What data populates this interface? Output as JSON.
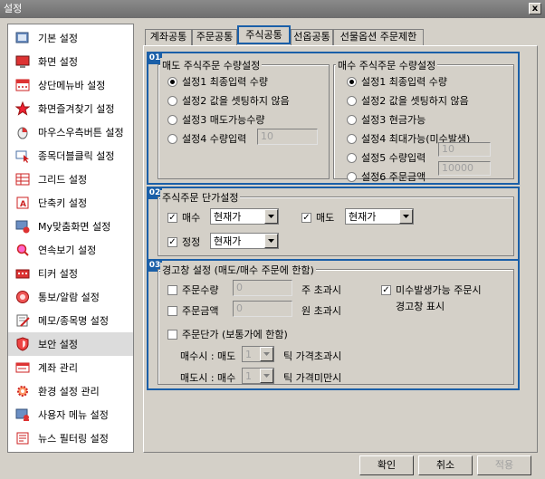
{
  "window": {
    "title": "설정",
    "close_label": "x"
  },
  "sidebar": {
    "items": [
      {
        "label": "기본 설정",
        "icon": "settings-icon"
      },
      {
        "label": "화면 설정",
        "icon": "monitor-icon"
      },
      {
        "label": "상단메뉴바 설정",
        "icon": "menubar-icon"
      },
      {
        "label": "화면즐겨찾기 설정",
        "icon": "star-icon"
      },
      {
        "label": "마우스우측버튼 설정",
        "icon": "mouse-icon"
      },
      {
        "label": "종목더블클릭 설정",
        "icon": "cursor-icon"
      },
      {
        "label": "그리드 설정",
        "icon": "grid-icon"
      },
      {
        "label": "단축키 설정",
        "icon": "shortcut-icon"
      },
      {
        "label": "My맞춤화면 설정",
        "icon": "custom-screen-icon"
      },
      {
        "label": "연속보기 설정",
        "icon": "magnifier-icon"
      },
      {
        "label": "티커 설정",
        "icon": "ticker-icon"
      },
      {
        "label": "통보/알람 설정",
        "icon": "alarm-icon"
      },
      {
        "label": "메모/종목명 설정",
        "icon": "memo-icon"
      },
      {
        "label": "보안 설정",
        "icon": "shield-icon"
      },
      {
        "label": "계좌 관리",
        "icon": "account-icon"
      },
      {
        "label": "환경 설정 관리",
        "icon": "gear-icon"
      },
      {
        "label": "사용자 메뉴 설정",
        "icon": "user-menu-icon"
      },
      {
        "label": "뉴스 필터링 설정",
        "icon": "news-icon"
      }
    ],
    "active_index": 13
  },
  "tabs": [
    {
      "label": "계좌공통"
    },
    {
      "label": "주문공통"
    },
    {
      "label": "주식공통"
    },
    {
      "label": "선옵공통"
    },
    {
      "label": "선물옵션 주문제한"
    }
  ],
  "active_tab": 2,
  "section1": {
    "badge": "01",
    "sell": {
      "legend": "매도 주식주문 수량설정",
      "options": [
        "설정1 최종입력 수량",
        "설정2 값을 셋팅하지 않음",
        "설정3 매도가능수량",
        "설정4 수량입력"
      ],
      "selected": 0,
      "qty_value": "10"
    },
    "buy": {
      "legend": "매수 주식주문 수량설정",
      "options": [
        "설정1 최종입력 수량",
        "설정2 값을 셋팅하지 않음",
        "설정3 현금가능",
        "설정4 최대가능(미수발생)",
        "설정5 수량입력",
        "설정6 주문금액"
      ],
      "selected": 0,
      "qty_value": "10",
      "amount_value": "10000"
    }
  },
  "section2": {
    "badge": "02",
    "legend": "주식주문 단가설정",
    "buy": {
      "label": "매수",
      "checked": true,
      "value": "현재가"
    },
    "sell": {
      "label": "매도",
      "checked": true,
      "value": "현재가"
    },
    "correct": {
      "label": "정정",
      "checked": true,
      "value": "현재가"
    }
  },
  "section3": {
    "badge": "03",
    "legend": "경고창 설정 (매도/매수 주문에 한함)",
    "order_qty": {
      "label": "주문수량",
      "value": "0",
      "suffix": "주 초과시"
    },
    "order_amount": {
      "label": "주문금액",
      "value": "0",
      "suffix": "원 초과시"
    },
    "unpaid_warning": {
      "label": "미수발생가능 주문시",
      "label2": "경고창 표시"
    },
    "unit_price": {
      "label": "주문단가 (보통가에 한함)"
    },
    "buy_line": {
      "prefix": "매수시 : 매도",
      "value": "1",
      "suffix": "틱 가격초과시"
    },
    "sell_line": {
      "prefix": "매도시 : 매수",
      "value": "1",
      "suffix": "틱 가격미만시"
    }
  },
  "buttons": {
    "ok": "확인",
    "cancel": "취소",
    "apply": "적용"
  }
}
